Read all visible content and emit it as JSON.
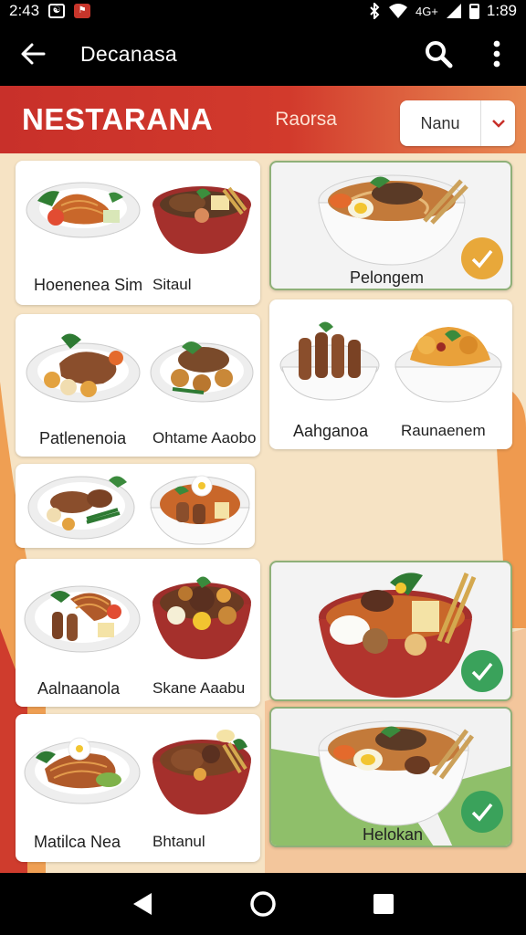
{
  "status_bar": {
    "time": "2:43",
    "icon1": "☯",
    "icon2": "⚑",
    "network": "4G+",
    "battery_time": "1:89"
  },
  "app_bar": {
    "title": "Decanasa",
    "back_icon": "arrow-left-icon",
    "search_icon": "search-icon",
    "more_icon": "more-vert-icon"
  },
  "header": {
    "brand": "NESTARANA",
    "subtitle": "Raorsa",
    "menu_select_label": "Nanu",
    "colors": {
      "banner": "#c8302a",
      "accent": "#e98a52"
    }
  },
  "cards": {
    "c1": {
      "left_label": "Hoenenea Sim",
      "right_label": "Sitaul"
    },
    "c2": {
      "label": "Pelongem",
      "checked": true
    },
    "c3": {
      "left_label": "Patlenenoia",
      "right_label": "Ohtame Aaobo"
    },
    "c4": {
      "left_label": "Aahganoa",
      "right_label": "Raunaenem"
    },
    "c5": {
      "left_label": "",
      "right_label": ""
    },
    "c6": {
      "left_label": "Aalnaanola",
      "right_label": "Skane Aaabu"
    },
    "c7": {
      "label": "",
      "checked": true
    },
    "c8": {
      "left_label": "Matilca Nea",
      "right_label": "Bhtanul"
    },
    "c9": {
      "label": "Helokan",
      "checked": true
    }
  },
  "check_colors": {
    "gold": "#e8a83a",
    "green": "#3aa25b"
  },
  "nav_bar": {
    "back_icon": "nav-back-icon",
    "home_icon": "nav-home-icon",
    "recents_icon": "nav-recents-icon"
  }
}
